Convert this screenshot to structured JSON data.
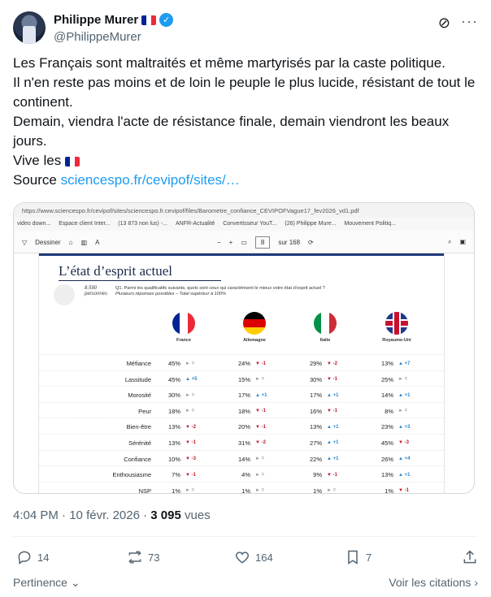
{
  "author": {
    "name": "Philippe Murer",
    "handle": "@PhilippeMurer",
    "flag_colors": [
      "#002395",
      "#ffffff",
      "#ed2939"
    ],
    "verified": true
  },
  "tweet": {
    "lines": [
      "Les Français sont maltraités et même martyrisés par la caste politique.",
      "Il n'en reste pas moins et de loin le peuple le plus lucide, résistant de tout le continent.",
      "Demain, viendra l'acte de résistance finale, demain viendront les beaux jours.",
      "Vive les"
    ],
    "source_label": "Source",
    "source_link": "sciencespo.fr/cevipof/sites/…"
  },
  "screenshot": {
    "url": "https://www.sciencespo.fr/cevipof/sites/sciencespo.fr.cevipof/files/Barometre_confiance_CEVIPOFVague17_fev2026_vd1.pdf",
    "bookmarks": [
      "video down...",
      "Espace client Inter...",
      "(13 873 non lus) -...",
      "ANFR-Actualité",
      "Convertisseur YouT...",
      "(26) Philippe Mure...",
      "Mouvement Politiq..."
    ],
    "toolbar": {
      "draw": "Dessiner",
      "page_current": "8",
      "page_total": "sur 168",
      "zoom_minus": "−",
      "zoom_plus": "+"
    },
    "slide": {
      "title": "L’état d’esprit actuel",
      "sample_count": "8.590",
      "sample_label": "personnes",
      "question": "Q1. Parmi les qualificatifs suivants, quels sont ceux qui caractérisent le mieux votre état d’esprit actuel ?",
      "question_note": "Plusieurs réponses possibles – Total supérieur à 100%",
      "countries": [
        "France",
        "Allemagne",
        "Italie",
        "Royaume-Uni"
      ],
      "rows": [
        {
          "label": "Méfiance",
          "cells": [
            [
              "45%",
              "eq",
              "="
            ],
            [
              "24%",
              "down",
              "-1"
            ],
            [
              "29%",
              "down",
              "-2"
            ],
            [
              "13%",
              "up",
              "+7"
            ]
          ]
        },
        {
          "label": "Lassitude",
          "cells": [
            [
              "45%",
              "up",
              "+5"
            ],
            [
              "15%",
              "eq",
              "="
            ],
            [
              "30%",
              "down",
              "-1"
            ],
            [
              "25%",
              "eq",
              "="
            ]
          ]
        },
        {
          "label": "Morosité",
          "cells": [
            [
              "30%",
              "eq",
              "="
            ],
            [
              "17%",
              "up",
              "+1"
            ],
            [
              "17%",
              "up",
              "+1"
            ],
            [
              "14%",
              "up",
              "+1"
            ]
          ]
        },
        {
          "label": "Peur",
          "cells": [
            [
              "18%",
              "eq",
              "="
            ],
            [
              "18%",
              "down",
              "-1"
            ],
            [
              "16%",
              "down",
              "-1"
            ],
            [
              "8%",
              "eq",
              "="
            ]
          ]
        },
        {
          "label": "Bien-être",
          "cells": [
            [
              "13%",
              "down",
              "-2"
            ],
            [
              "20%",
              "down",
              "-1"
            ],
            [
              "13%",
              "up",
              "+1"
            ],
            [
              "23%",
              "up",
              "+3"
            ]
          ]
        },
        {
          "label": "Sérénité",
          "cells": [
            [
              "13%",
              "down",
              "-1"
            ],
            [
              "31%",
              "down",
              "-2"
            ],
            [
              "27%",
              "up",
              "+1"
            ],
            [
              "45%",
              "down",
              "-3"
            ]
          ]
        },
        {
          "label": "Confiance",
          "cells": [
            [
              "10%",
              "down",
              "-3"
            ],
            [
              "14%",
              "eq",
              "="
            ],
            [
              "22%",
              "up",
              "+1"
            ],
            [
              "26%",
              "up",
              "+4"
            ]
          ]
        },
        {
          "label": "Enthousiasme",
          "cells": [
            [
              "7%",
              "down",
              "-1"
            ],
            [
              "4%",
              "eq",
              "="
            ],
            [
              "9%",
              "down",
              "-1"
            ],
            [
              "13%",
              "up",
              "+1"
            ]
          ]
        },
        {
          "label": "NSP",
          "cells": [
            [
              "1%",
              "eq",
              "="
            ],
            [
              "1%",
              "eq",
              "="
            ],
            [
              "1%",
              "eq",
              "="
            ],
            [
              "1%",
              "down",
              "-1"
            ]
          ]
        }
      ]
    }
  },
  "meta": {
    "time": "4:04 PM",
    "date": "10 févr. 2026",
    "views_count": "3 095",
    "views_label": "vues"
  },
  "actions": {
    "replies": "14",
    "reposts": "73",
    "likes": "164",
    "bookmarks": "7"
  },
  "footer": {
    "relevance": "Pertinence",
    "quotes": "Voir les citations"
  },
  "colors": {
    "link": "#1d9bf0",
    "muted": "#536471",
    "trend_up": "#2a83c7",
    "trend_down": "#c0182b"
  }
}
